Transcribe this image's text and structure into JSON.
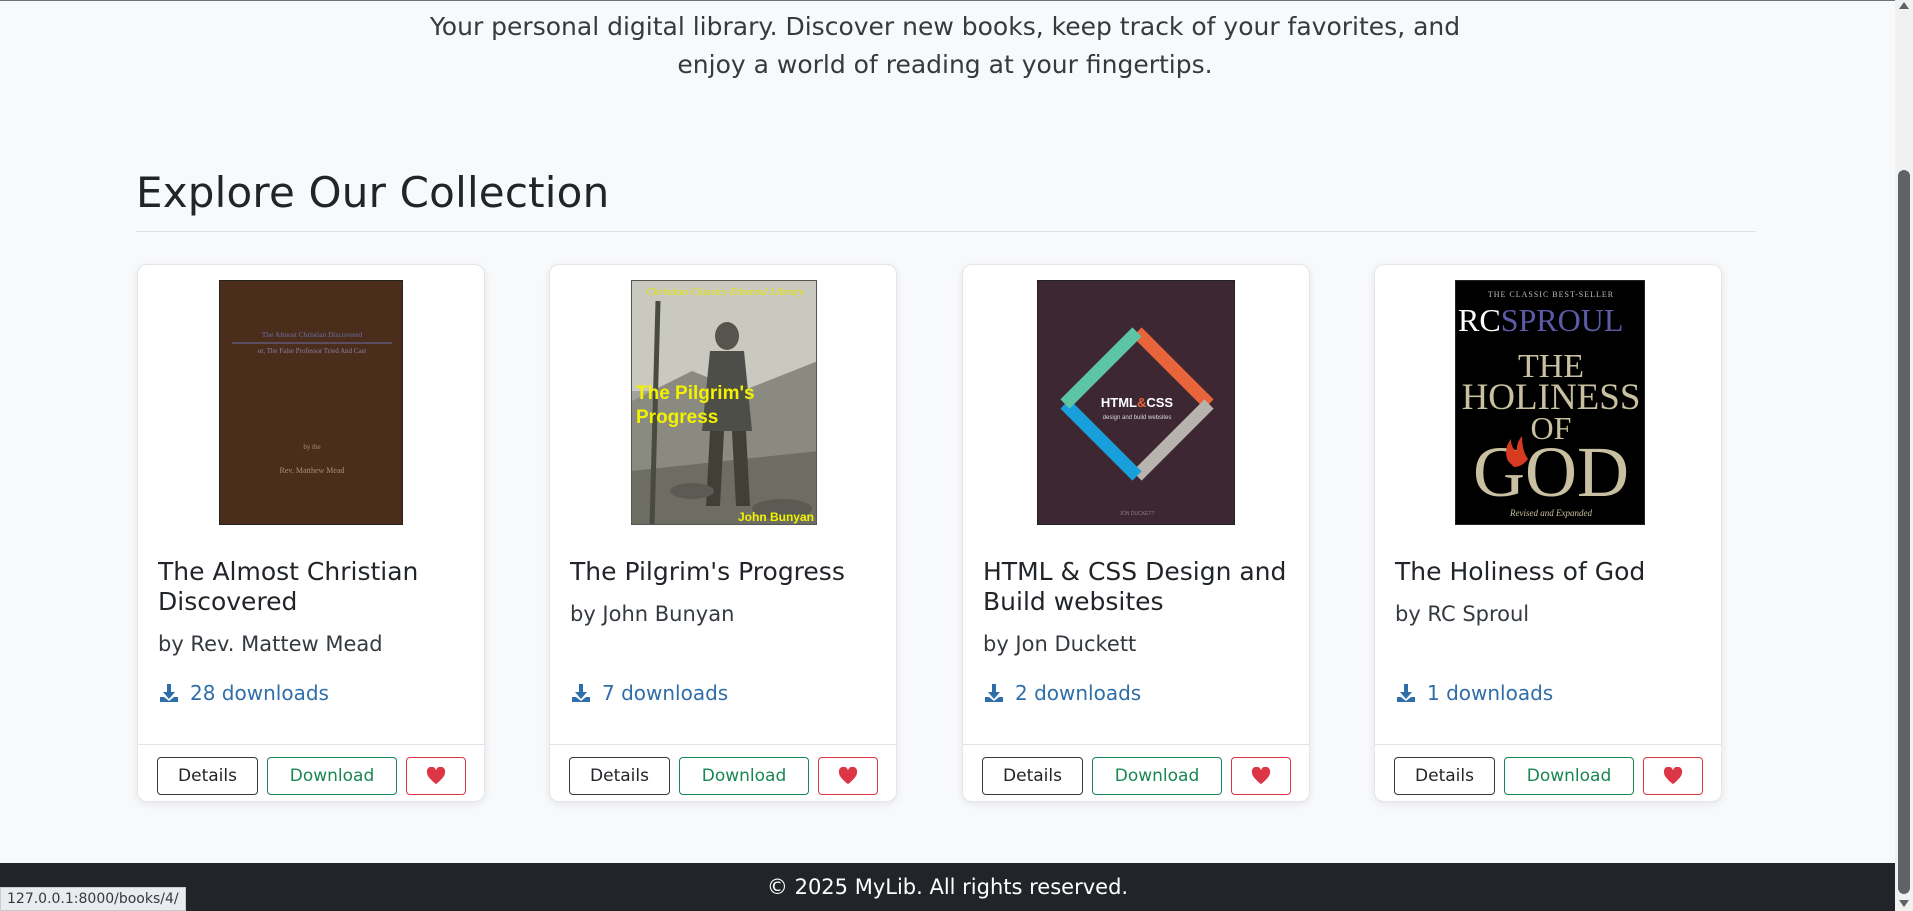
{
  "hero": {
    "tagline": "Your personal digital library. Discover new books, keep track of your favorites, and enjoy a world of reading at your fingertips."
  },
  "collection": {
    "title": "Explore Our Collection",
    "books": [
      {
        "title": "The Almost Christian Discovered",
        "author": "by Rev. Mattew Mead",
        "downloads": "28 downloads",
        "cover": {
          "line1": "The Almost Christian Discovered",
          "line2": "or, The False Professor Tried And Cast",
          "byline": "by the",
          "name": "Rev. Matthew Mead"
        }
      },
      {
        "title": "The Pilgrim's Progress",
        "author": "by John Bunyan",
        "downloads": "7 downloads",
        "cover": {
          "series": "Christian Classics Ethereal Library",
          "title": "The Pilgrim's Progress",
          "author": "John Bunyan"
        }
      },
      {
        "title": "HTML & CSS Design and Build websites",
        "author": "by Jon Duckett",
        "downloads": "2 downloads",
        "cover": {
          "html": "HTML",
          "amp": "&",
          "css": "CSS",
          "subtitle": "design and build websites",
          "author": "JON DUCKETT"
        }
      },
      {
        "title": "The Holiness of God",
        "author": "by RC Sproul",
        "downloads": "1 downloads",
        "cover": {
          "tag": "THE CLASSIC BEST-SELLER",
          "rc": "RC",
          "sproul": "SPROUL",
          "the": "THE",
          "holiness": "HOLINESS",
          "of": "OF",
          "god": "GOD",
          "edition": "Revised and Expanded"
        }
      }
    ],
    "buttons": {
      "details": "Details",
      "download": "Download"
    }
  },
  "footer": {
    "text": "© 2025 MyLib. All rights reserved."
  },
  "status_bar": {
    "url": "127.0.0.1:8000/books/4/"
  },
  "colors": {
    "download_link": "#2f6ea8",
    "download_button": "#198754",
    "favorite_button": "#dc3545",
    "footer_bg": "#212529"
  }
}
